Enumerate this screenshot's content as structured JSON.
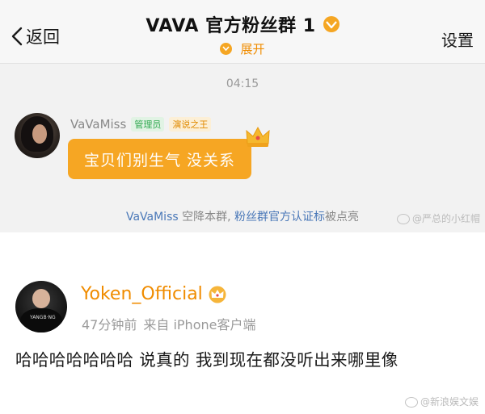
{
  "chat": {
    "header": {
      "back_label": "返回",
      "title": "VAVA 官方粉丝群 1",
      "expand_label": "展开",
      "settings_label": "设置"
    },
    "timestamp": "04:15",
    "message": {
      "sender": "VaVaMiss",
      "tags": [
        "管理员",
        "演说之王"
      ],
      "text": "宝贝们别生气 没关系"
    },
    "notice": {
      "name": "VaVaMiss",
      "text1": " 空降本群, ",
      "link": "粉丝群官方认证标",
      "text2": "被点亮"
    },
    "watermark": "@严总的小红帽"
  },
  "post": {
    "author": "Yoken_Official",
    "time_ago": "47分钟前",
    "source": "来自 iPhone客户端",
    "text": "哈哈哈哈哈哈哈 说真的 我到现在都没听出来哪里像",
    "watermark": "@新浪娱文娱"
  },
  "colors": {
    "accent_orange": "#f6a623",
    "name_orange": "#f08c00",
    "link_blue": "#4a78b8",
    "admin_green": "#2fa84f"
  },
  "icons": [
    "chevron-left-icon",
    "vip-badge-icon",
    "chevron-down-icon",
    "crown-icon",
    "weibo-watermark-icon"
  ]
}
